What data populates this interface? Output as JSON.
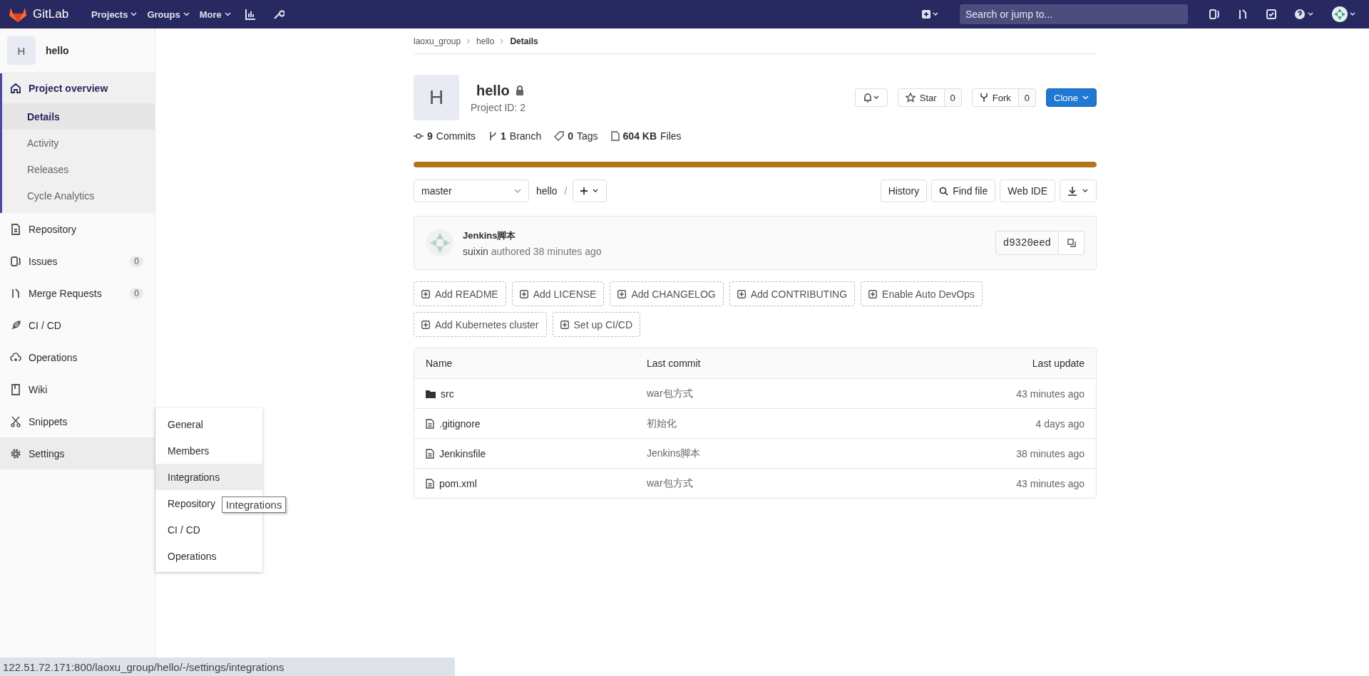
{
  "topbar": {
    "brand": "GitLab",
    "nav": [
      "Projects",
      "Groups",
      "More"
    ],
    "search": {
      "placeholder": "Search or jump to..."
    }
  },
  "sidebar": {
    "project": {
      "avatar": "H",
      "name": "hello"
    },
    "items": [
      {
        "label": "Project overview",
        "selected": true,
        "hovered": false,
        "children": [
          {
            "label": "Details",
            "selected": true
          },
          {
            "label": "Activity",
            "selected": false
          },
          {
            "label": "Releases",
            "selected": false
          },
          {
            "label": "Cycle Analytics",
            "selected": false
          }
        ]
      },
      {
        "label": "Repository",
        "selected": false,
        "hovered": false
      },
      {
        "label": "Issues",
        "selected": false,
        "hovered": false,
        "badge": "0"
      },
      {
        "label": "Merge Requests",
        "selected": false,
        "hovered": false,
        "badge": "0"
      },
      {
        "label": "CI / CD",
        "selected": false,
        "hovered": false
      },
      {
        "label": "Operations",
        "selected": false,
        "hovered": false
      },
      {
        "label": "Wiki",
        "selected": false,
        "hovered": false
      },
      {
        "label": "Snippets",
        "selected": false,
        "hovered": false
      },
      {
        "label": "Settings",
        "selected": false,
        "hovered": true
      }
    ]
  },
  "flyout": {
    "items": [
      {
        "label": "General",
        "hovered": false
      },
      {
        "label": "Members",
        "hovered": false
      },
      {
        "label": "Integrations",
        "hovered": true
      },
      {
        "label": "Repository",
        "hovered": false
      },
      {
        "label": "CI / CD",
        "hovered": false
      },
      {
        "label": "Operations",
        "hovered": false
      }
    ],
    "tooltip": "Integrations"
  },
  "breadcrumbs": [
    "laoxu_group",
    "hello",
    "Details"
  ],
  "project": {
    "avatar": "H",
    "name": "hello",
    "id": "Project ID: 2",
    "star": {
      "label": "Star",
      "count": "0"
    },
    "fork": {
      "label": "Fork",
      "count": "0"
    },
    "clone": "Clone"
  },
  "stats": [
    {
      "value": "9",
      "label": "Commits"
    },
    {
      "value": "1",
      "label": "Branch"
    },
    {
      "value": "0",
      "label": "Tags"
    },
    {
      "value": "604 KB",
      "label": "Files"
    }
  ],
  "storage": {
    "level": 1
  },
  "repo_bar": {
    "branch": "master",
    "path": "hello",
    "separator": "/",
    "buttons": [
      "History",
      "Find file",
      "Web IDE"
    ]
  },
  "commit": {
    "title": "Jenkins脚本",
    "author": "suixin",
    "meta": "authored 38 minutes ago",
    "sha": "d9320eed"
  },
  "quick_actions": [
    "Add README",
    "Add LICENSE",
    "Add CHANGELOG",
    "Add CONTRIBUTING",
    "Enable Auto DevOps",
    "Add Kubernetes cluster",
    "Set up CI/CD"
  ],
  "files": {
    "columns": [
      "Name",
      "Last commit",
      "Last update"
    ],
    "rows": [
      {
        "kind": "folder",
        "name": "src",
        "commit": "war包方式",
        "updated": "43 minutes ago"
      },
      {
        "kind": "file",
        "name": ".gitignore",
        "commit": "初始化",
        "updated": "4 days ago"
      },
      {
        "kind": "file",
        "name": "Jenkinsfile",
        "commit": "Jenkins脚本",
        "updated": "38 minutes ago"
      },
      {
        "kind": "file",
        "name": "pom.xml",
        "commit": "war包方式",
        "updated": "43 minutes ago"
      }
    ]
  },
  "status_bar": "122.51.72.171:800/laoxu_group/hello/-/settings/integrations"
}
